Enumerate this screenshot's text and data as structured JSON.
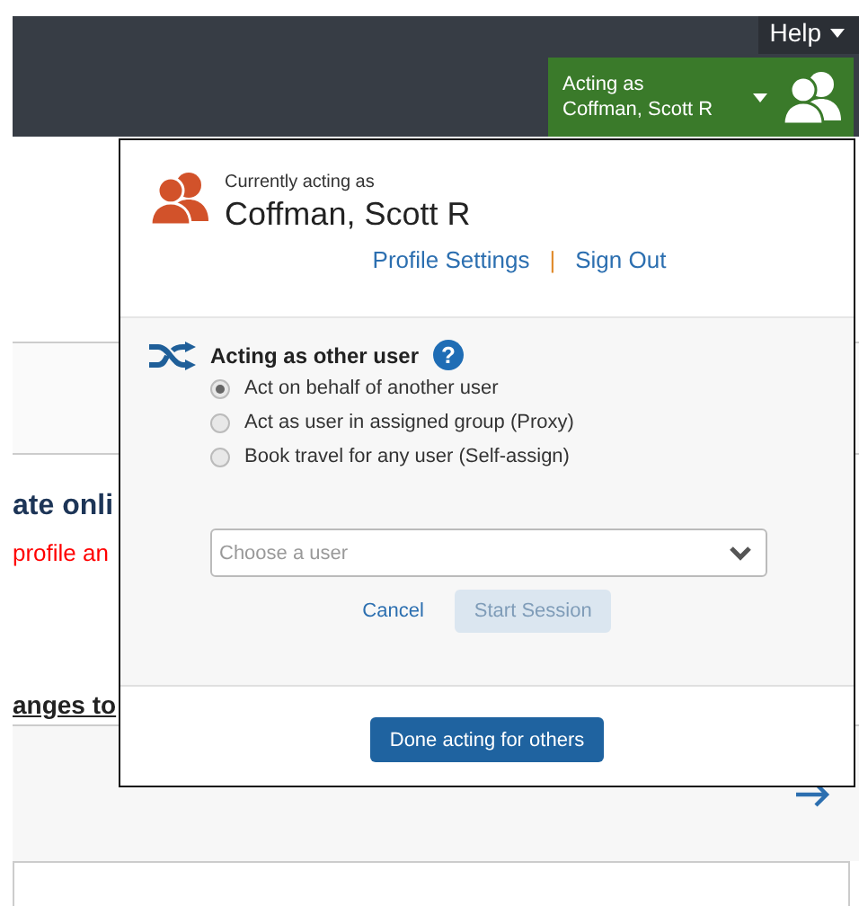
{
  "header": {
    "help": "Help",
    "acting_label": "Acting as",
    "acting_name": "Coffman, Scott R"
  },
  "background": {
    "heading": "ate onli",
    "notice": "profile an",
    "link": "anges to"
  },
  "popup": {
    "current_label": "Currently acting as",
    "current_name": "Coffman, Scott R",
    "profile_link": "Profile Settings",
    "separator": "|",
    "sign_out": "Sign Out",
    "section_title": "Acting as other user",
    "help_icon": "?",
    "options": [
      {
        "label": "Act on behalf of another user",
        "selected": true
      },
      {
        "label": "Act as user in assigned group (Proxy)",
        "selected": false
      },
      {
        "label": "Book travel for any user (Self-assign)",
        "selected": false
      }
    ],
    "user_select": {
      "placeholder": "Choose a user"
    },
    "cancel": "Cancel",
    "start": {
      "label": "Start Session",
      "disabled": true
    },
    "done": "Done acting for others"
  }
}
